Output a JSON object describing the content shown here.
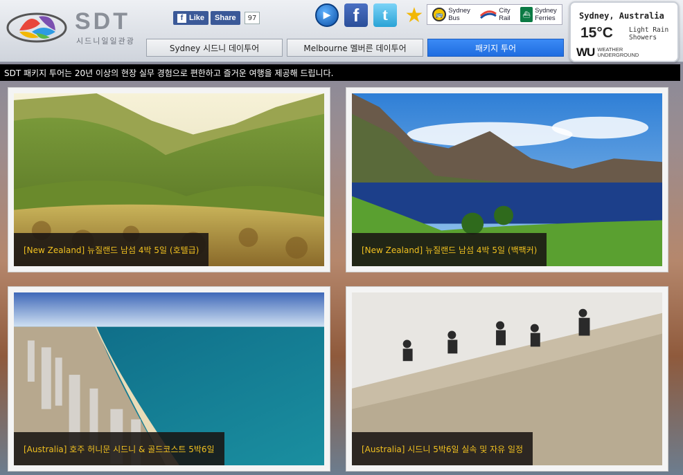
{
  "brand": {
    "name": "SDT",
    "subtitle": "시드니일일관광"
  },
  "social": {
    "like_label": "Like",
    "share_label": "Share",
    "share_count": "97"
  },
  "header_icons": [
    "play-icon",
    "facebook-icon",
    "twitter-icon",
    "star-icon"
  ],
  "transport": [
    {
      "name": "Sydney Bus",
      "line1": "Sydney",
      "line2": "Bus"
    },
    {
      "name": "City Rail",
      "line1": "City",
      "line2": "Rail"
    },
    {
      "name": "Sydney Ferries",
      "line1": "Sydney",
      "line2": "Ferries"
    }
  ],
  "tabs": [
    {
      "label": "Sydney 시드니 데이투어",
      "active": false
    },
    {
      "label": "Melbourne 멜버른 데이투어",
      "active": false
    },
    {
      "label": "패키지 투어",
      "active": true
    }
  ],
  "weather": {
    "city": "Sydney, Australia",
    "temperature": "15°C",
    "condition": "Light Rain Showers",
    "provider_logo": "WU",
    "provider_line1": "WEATHER",
    "provider_line2": "UNDERGROUND"
  },
  "banner": "SDT 패키지 투어는 20년 이상의 현장 실무 경험으로 편한하고 즐거운 여행을 제공해 드립니다.",
  "tours": [
    {
      "caption": "[New Zealand] 뉴질랜드 남섬 4박 5일 (호텔급)"
    },
    {
      "caption": "[New Zealand] 뉴질랜드 남섬 4박 5일 (백팩커)"
    },
    {
      "caption": "[Australia] 호주 허니문 시드니 & 골드코스트 5박6일"
    },
    {
      "caption": "[Australia] 시드니 5박6일 실속 및 자유 일정"
    }
  ]
}
